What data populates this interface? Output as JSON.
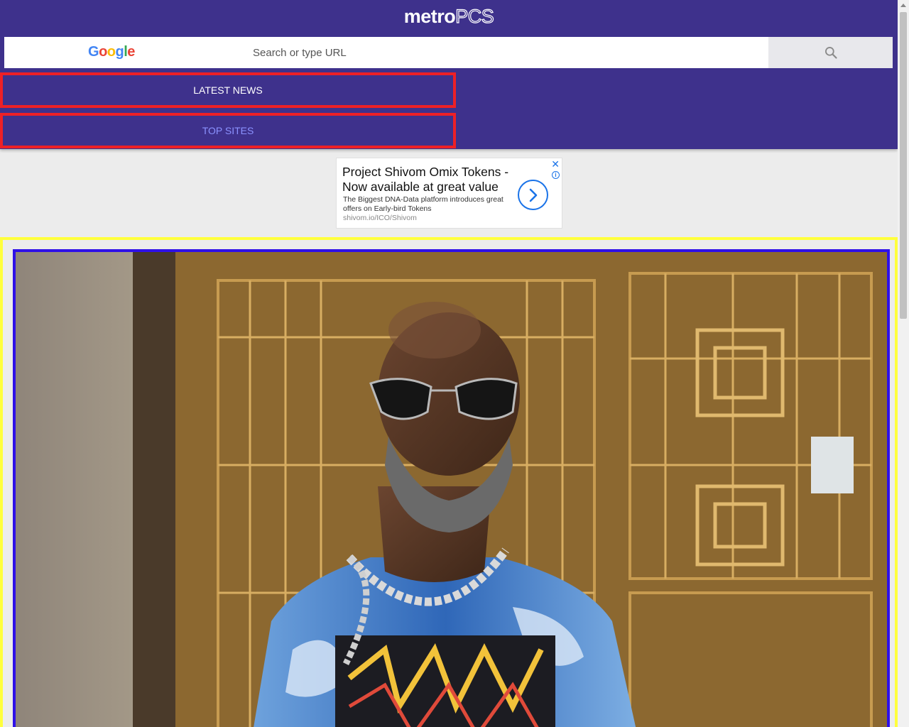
{
  "header": {
    "logo_bold": "metro",
    "logo_thin": "PCS",
    "bg_color": "#3e318c"
  },
  "search": {
    "google_logo": "Google",
    "placeholder": "Search or type URL",
    "button_icon": "search-icon"
  },
  "tabs": [
    {
      "label": "LATEST NEWS"
    },
    {
      "label": "TOP SITES"
    }
  ],
  "ad": {
    "title": "Project Shivom Omix Tokens - Now available at great value",
    "description": "The Biggest DNA-Data platform introduces great offers on Early-bird Tokens",
    "url": "shivom.io/ICO/Shivom",
    "close_glyph": "✕",
    "info_glyph": "i"
  },
  "colors": {
    "tab_border": "#ee2026",
    "card_outer_border": "#ffff3c",
    "card_inner_border": "#2f10e8"
  }
}
